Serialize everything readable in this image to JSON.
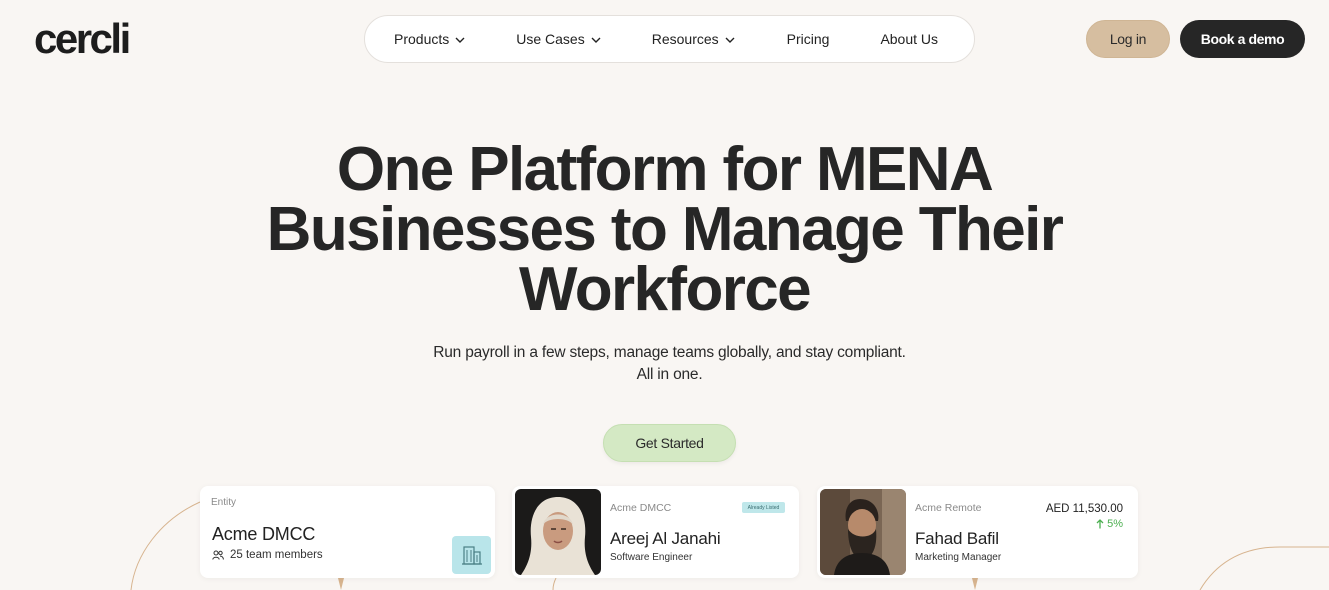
{
  "brand": {
    "logo": "cercli"
  },
  "nav": {
    "items": [
      {
        "label": "Products",
        "has_dropdown": true
      },
      {
        "label": "Use Cases",
        "has_dropdown": true
      },
      {
        "label": "Resources",
        "has_dropdown": true
      },
      {
        "label": "Pricing",
        "has_dropdown": false
      },
      {
        "label": "About Us",
        "has_dropdown": false
      }
    ]
  },
  "header": {
    "login_label": "Log in",
    "demo_label": "Book a demo"
  },
  "hero": {
    "title_line1": "One Platform for MENA",
    "title_line2": "Businesses to Manage Their",
    "title_line3": "Workforce",
    "subtitle_line1": "Run payroll in a few steps, manage teams globally, and stay compliant.",
    "subtitle_line2": "All in one.",
    "cta_label": "Get Started"
  },
  "cards": {
    "entity": {
      "label": "Entity",
      "name": "Acme DMCC",
      "team": "25 team members",
      "icon": "building-icon"
    },
    "employee": {
      "company": "Acme DMCC",
      "name": "Areej Al Janahi",
      "role": "Software Engineer",
      "badge": "Already Listed"
    },
    "payroll": {
      "company": "Acme Remote",
      "name": "Fahad Bafil",
      "role": "Marketing Manager",
      "amount": "AED 11,530.00",
      "change": "5%"
    }
  },
  "colors": {
    "background": "#f9f6f3",
    "login_button": "#d6bea0",
    "demo_button": "#262626",
    "cta_button": "#d4e9c4",
    "entity_icon_bg": "#b9e5ea",
    "positive": "#4caf50",
    "deco_line": "#d7b48f"
  }
}
